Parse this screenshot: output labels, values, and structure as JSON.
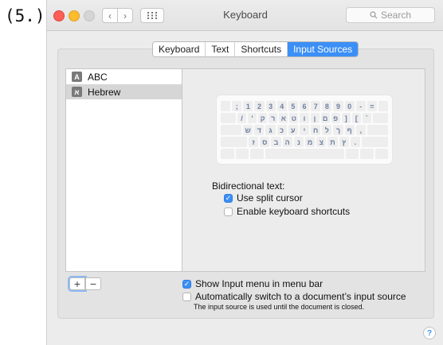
{
  "step_label": "(5.)",
  "window": {
    "title": "Keyboard",
    "search_placeholder": "Search",
    "icons": {
      "back": "chevron-left-icon",
      "forward": "chevron-right-icon",
      "grid": "grid-icon",
      "search": "magnifier-icon"
    }
  },
  "tabs": [
    {
      "label": "Keyboard",
      "active": false
    },
    {
      "label": "Text",
      "active": false
    },
    {
      "label": "Shortcuts",
      "active": false
    },
    {
      "label": "Input Sources",
      "active": true
    }
  ],
  "input_sources": [
    {
      "icon_letter": "A",
      "label": "ABC",
      "selected": false
    },
    {
      "icon_letter": "א",
      "label": "Hebrew",
      "selected": true
    }
  ],
  "keyboard_preview": {
    "rows": [
      [
        ";",
        "1",
        "2",
        "3",
        "4",
        "5",
        "6",
        "7",
        "8",
        "9",
        "0",
        "-",
        "="
      ],
      [
        "/",
        "'",
        "ק",
        "ר",
        "א",
        "ט",
        "ו",
        "ן",
        "ם",
        "פ",
        "]",
        "[",
        "`"
      ],
      [
        "ש",
        "ד",
        "ג",
        "כ",
        "ע",
        "י",
        "ח",
        "ל",
        "ך",
        "ף",
        ","
      ],
      [
        "ז",
        "ס",
        "ב",
        "ה",
        "נ",
        "מ",
        "צ",
        "ת",
        "ץ",
        "."
      ],
      [
        " "
      ]
    ]
  },
  "bidi": {
    "heading": "Bidirectional text:",
    "use_split_cursor": {
      "label": "Use split cursor",
      "checked": true
    },
    "enable_kbd_shortcuts": {
      "label": "Enable keyboard shortcuts",
      "checked": false
    }
  },
  "buttons": {
    "add": "+",
    "remove": "−"
  },
  "options": {
    "show_input_menu": {
      "label": "Show Input menu in menu bar",
      "checked": true
    },
    "auto_switch": {
      "label": "Automatically switch to a document’s input source",
      "checked": false
    },
    "note": "The input source is used until the document is closed."
  },
  "help": "?",
  "accent_color": "#3b8ff6"
}
